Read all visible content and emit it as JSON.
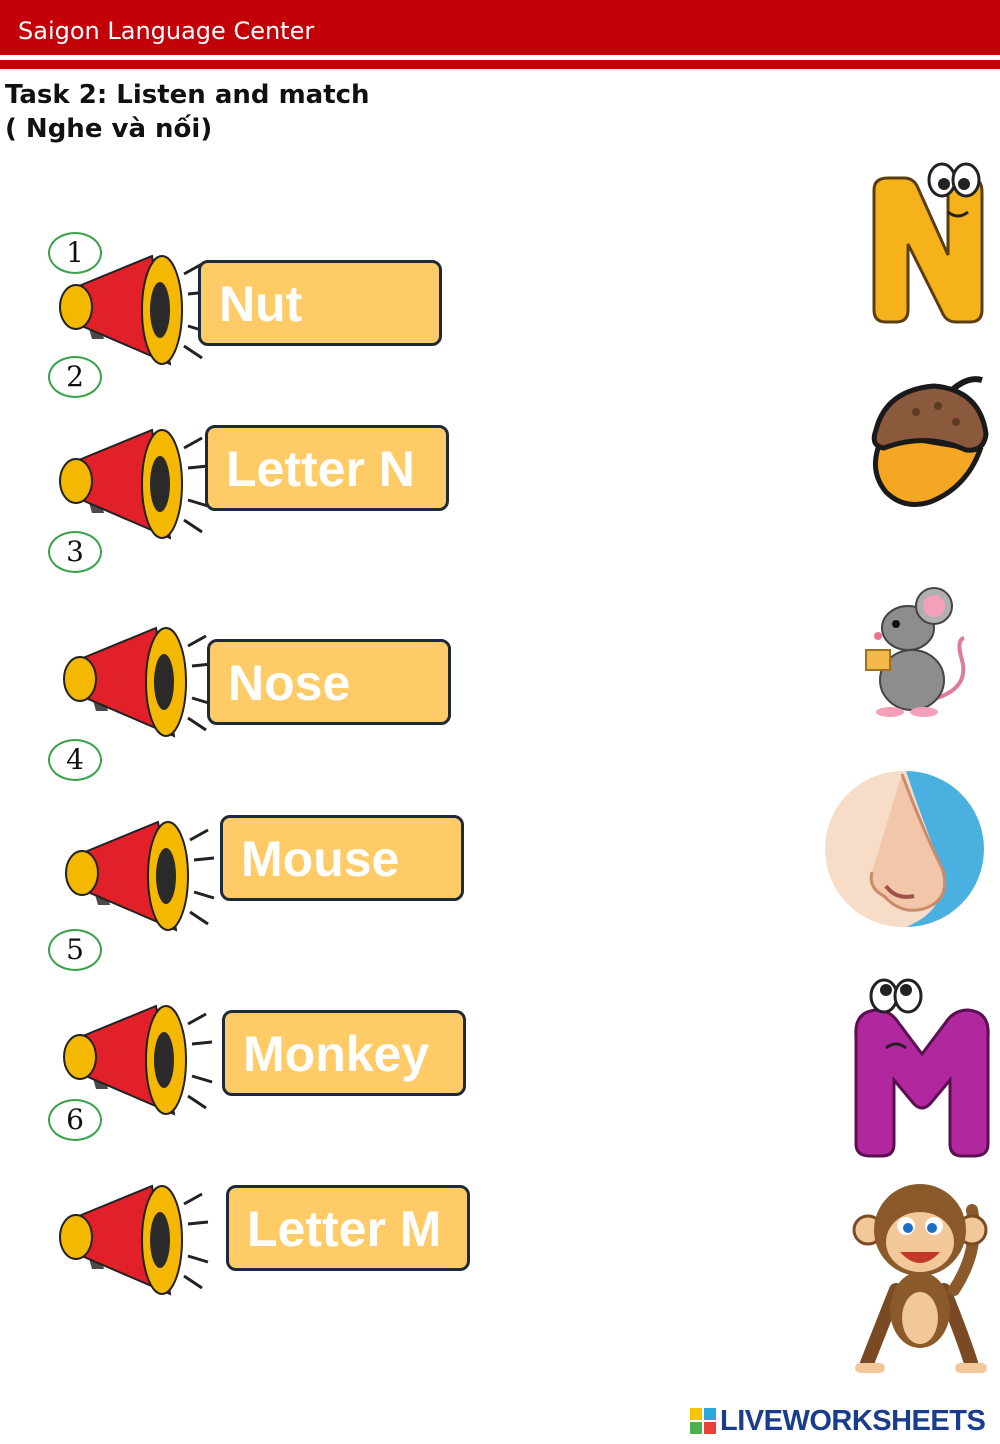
{
  "header": {
    "title": "Saigon Language Center",
    "brand_color": "#c30008"
  },
  "task": {
    "title": "Task 2: Listen and match",
    "subtitle": "( Nghe và nối)"
  },
  "numbers": [
    "1",
    "2",
    "3",
    "4",
    "5",
    "6"
  ],
  "words": [
    "Nut",
    "Letter N",
    "Nose",
    "Mouse",
    "Monkey",
    "Letter M"
  ],
  "pictures": [
    "letter-n-icon",
    "acorn-icon",
    "mouse-icon",
    "nose-icon",
    "letter-m-icon",
    "monkey-icon"
  ],
  "footer": {
    "brand": "LIVEWORKSHEETS"
  },
  "colors": {
    "word_box": "#ffcb66",
    "number_circle": "#3aa04a"
  }
}
